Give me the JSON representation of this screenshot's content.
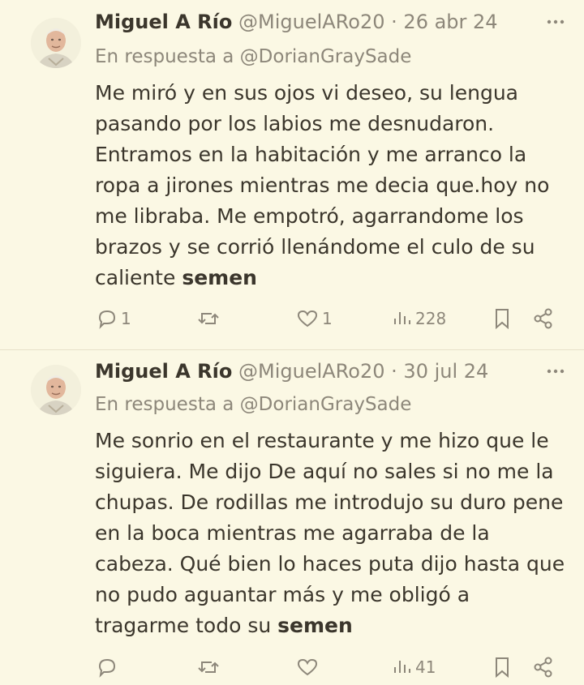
{
  "tweets": [
    {
      "author_name": "Miguel A Río",
      "handle": "@MiguelARo20",
      "separator": "·",
      "date": "26 abr 24",
      "reply_prefix": "En respuesta a",
      "reply_to": "@DorianGraySade",
      "text": "Me miró y en sus ojos vi deseo, su lengua pasando por los labios me desnudaron. Entramos en la habitación y me arranco la ropa a jirones mientras me decia que.hoy no me libraba. Me empotró, agarrandome los brazos y se corrió llenándome el culo de su caliente",
      "highlight": "semen",
      "replies": "1",
      "reposts": "",
      "likes": "1",
      "views": "228"
    },
    {
      "author_name": "Miguel A Río",
      "handle": "@MiguelARo20",
      "separator": "·",
      "date": "30 jul 24",
      "reply_prefix": "En respuesta a",
      "reply_to": "@DorianGraySade",
      "text": "Me sonrio en el restaurante y me hizo que le siguiera. Me dijo De aquí no sales si no me la chupas. De rodillas me introdujo su duro pene en la boca mientras me agarraba de la cabeza. Qué bien lo haces puta dijo hasta que no pudo aguantar más y me obligó a tragarme todo su",
      "highlight": "semen",
      "replies": "",
      "reposts": "",
      "likes": "",
      "views": "41"
    }
  ],
  "icons": {
    "reply": "comment-bubble-icon",
    "repost": "repost-arrows-icon",
    "like": "heart-icon",
    "views": "bar-chart-icon",
    "bookmark": "bookmark-icon",
    "share": "share-icon",
    "more": "more-dots-icon"
  },
  "colors": {
    "background": "#fbf8e4",
    "text": "#3b362c",
    "muted": "#8d877a",
    "divider": "#e6e1c9"
  }
}
